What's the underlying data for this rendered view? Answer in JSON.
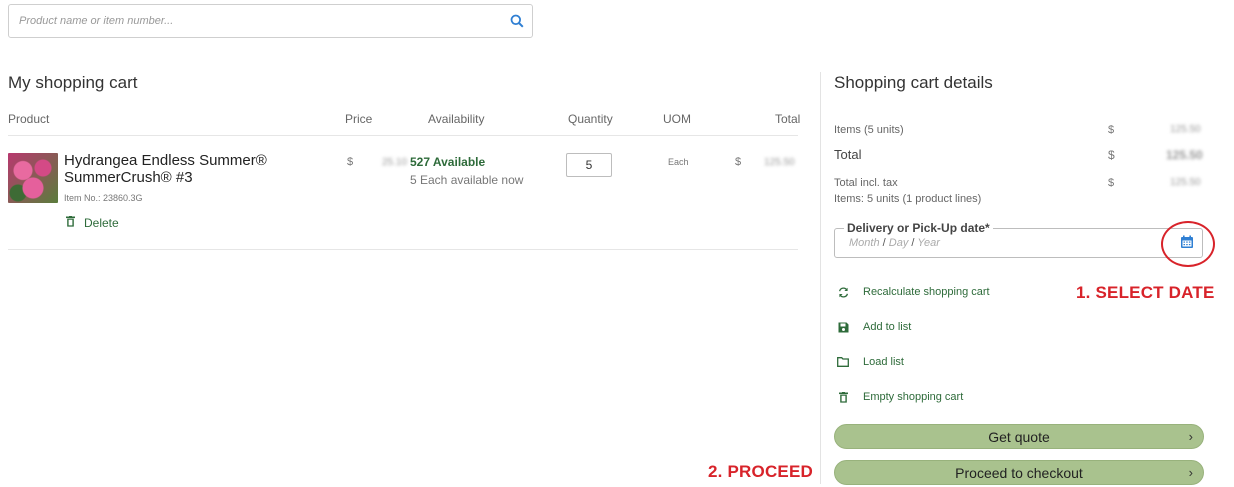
{
  "search": {
    "placeholder": "Product name or item number..."
  },
  "cart": {
    "title": "My shopping cart",
    "columns": {
      "product": "Product",
      "price": "Price",
      "availability": "Availability",
      "quantity": "Quantity",
      "uom": "UOM",
      "total": "Total"
    },
    "items": [
      {
        "name": "Hydrangea Endless Summer® SummerCrush® #3",
        "item_no": "Item No.: 23860.3G",
        "currency": "$",
        "price": "25.10",
        "availability": "527 Available",
        "availability_note": "5 Each available now",
        "quantity": "5",
        "uom": "Each",
        "total": "125.50",
        "delete_label": "Delete"
      }
    ]
  },
  "details": {
    "title": "Shopping cart details",
    "items_label": "Items (5 units)",
    "items_value": "125.50",
    "total_label": "Total",
    "total_value": "125.50",
    "total_tax_label": "Total incl. tax",
    "total_tax_value": "125.50",
    "lines_label": "Items: 5 units (1 product lines)",
    "currency": "$",
    "date_label": "Delivery or Pick-Up date*",
    "date_month": "Month",
    "date_day": "Day",
    "date_year": "Year",
    "date_sep": "/",
    "actions": {
      "recalculate": "Recalculate shopping cart",
      "add_to_list": "Add to list",
      "load_list": "Load list",
      "empty": "Empty shopping cart"
    },
    "quote_button": "Get quote",
    "checkout_button": "Proceed to checkout",
    "chevron": "›"
  },
  "annotations": {
    "select_date": "1. SELECT DATE",
    "proceed": "2. PROCEED"
  },
  "colors": {
    "accent_green": "#2e6b3a",
    "button_green": "#a9c28e",
    "annotation_red": "#d8232a",
    "calendar_blue": "#2f7fd3"
  },
  "icons": [
    "search-icon",
    "trash-icon",
    "calendar-icon",
    "refresh-icon",
    "save-icon",
    "folder-icon",
    "chevron-right-icon"
  ]
}
